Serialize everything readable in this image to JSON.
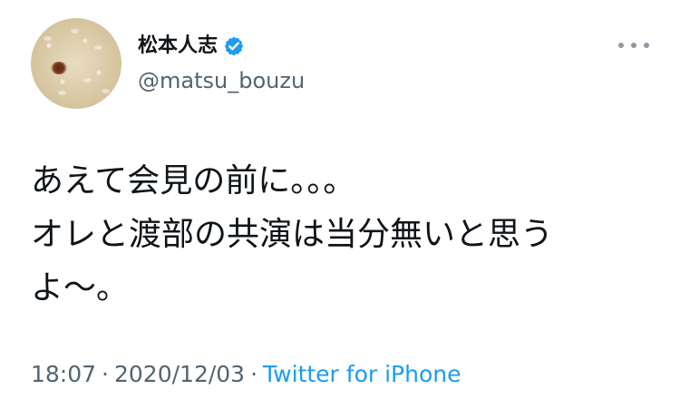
{
  "tweet": {
    "author": {
      "display_name": "松本人志",
      "username": "@matsu_bouzu",
      "verified": true,
      "avatar_icon": "rice-avatar"
    },
    "text": "あえて会見の前に。。。\nオレと渡部の共演は当分無いと思う\nよ〜。",
    "time": "18:07",
    "separator": "·",
    "date": "2020/12/03",
    "source": "Twitter for iPhone"
  },
  "colors": {
    "text": "#0f1419",
    "secondary": "#536471",
    "link": "#1d9bf0",
    "verified_badge": "#1d9bf0"
  },
  "icons": {
    "more": "more-options-icon",
    "verified": "verified-badge-icon"
  }
}
